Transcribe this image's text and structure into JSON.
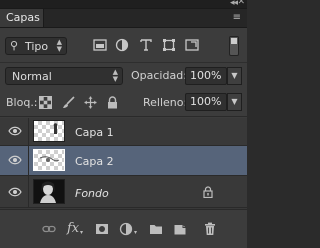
{
  "panel": {
    "title": "Capas"
  },
  "filter": {
    "kind_label": "Tipo"
  },
  "blend": {
    "mode": "Normal",
    "opacity_label": "Opacidad:",
    "opacity_value": "100%"
  },
  "lock": {
    "label": "Bloq.:",
    "fill_label": "Relleno:",
    "fill_value": "100%"
  },
  "layers": [
    {
      "name": "Capa 1",
      "visible": true,
      "selected": false
    },
    {
      "name": "Capa 2",
      "visible": true,
      "selected": true
    },
    {
      "name": "Fondo",
      "visible": true,
      "selected": false,
      "locked": true
    }
  ],
  "bottom": {
    "fx_label": "fx"
  }
}
